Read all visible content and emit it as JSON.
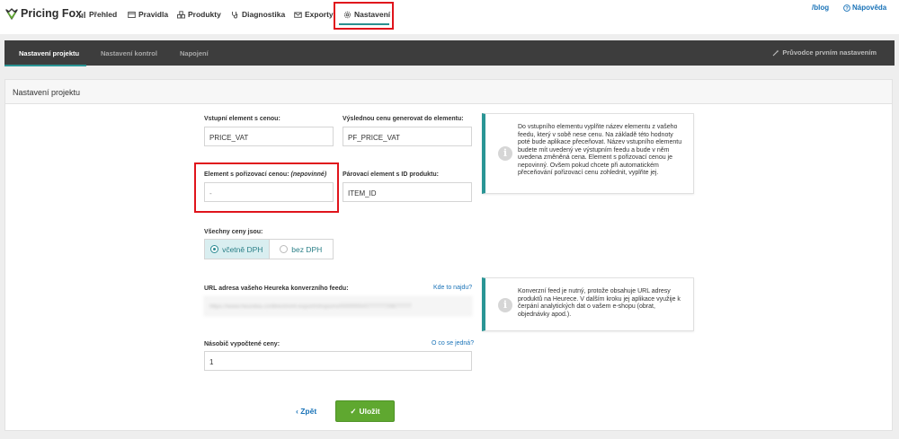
{
  "brand": {
    "name": "Pricing Fox"
  },
  "nav": {
    "items": [
      {
        "label": "Přehled",
        "icon": "chart-icon"
      },
      {
        "label": "Pravidla",
        "icon": "window-icon"
      },
      {
        "label": "Produkty",
        "icon": "cubes-icon"
      },
      {
        "label": "Diagnostika",
        "icon": "stethoscope-icon"
      },
      {
        "label": "Exporty",
        "icon": "envelope-icon"
      },
      {
        "label": "Nastavení",
        "icon": "gear-icon",
        "active": true
      }
    ],
    "blog": "/blog",
    "help": "Nápověda"
  },
  "subnav": {
    "tabs": [
      {
        "label": "Nastavení projektu",
        "active": true
      },
      {
        "label": "Nastavení kontrol"
      },
      {
        "label": "Napojení"
      }
    ],
    "wizard": "Průvodce prvním nastavením"
  },
  "panel": {
    "title": "Nastavení projektu",
    "input_element": {
      "label": "Vstupní element s cenou:",
      "value": "PRICE_VAT"
    },
    "output_element": {
      "label": "Výslednou cenu generovat do elementu:",
      "value": "PF_PRICE_VAT"
    },
    "purchase_element": {
      "label": "Element s pořizovací cenou:",
      "label_optional": "(nepovinné)",
      "value": "-"
    },
    "pairing_element": {
      "label": "Párovací element s ID produktu:",
      "value": "ITEM_ID"
    },
    "info_price": "Do vstupního elementu vyplňte název elementu z vašeho feedu, který v sobě nese cenu. Na základě této hodnoty poté bude aplikace přeceňovat. Název vstupního elementu budete mít uvedený ve výstupním feedu a bude v něm uvedena změněná cena. Element s pořizovací cenou je nepovinný. Ovšem pokud chcete při automatickém přeceňování pořizovací cenu zohlednit, vyplňte jej.",
    "prices": {
      "label": "Všechny ceny jsou:",
      "with_vat": "včetně DPH",
      "without_vat": "bez DPH",
      "selected": "with_vat"
    },
    "heureka_url": {
      "label": "URL adresa vašeho Heureka konverzního feedu:",
      "help": "Kde to najdu?",
      "value": "https://www.heureka.cz/direct/xml-export/shops/ro/0000000/0777777/0877777"
    },
    "info_feed": "Konverzní feed je nutný, protože obsahuje URL adresy produktů na Heurece. V dalším kroku jej aplikace využije k čerpání analytických dat o vašem e-shopu (obrat, objednávky apod.).",
    "multiplier": {
      "label": "Násobič vypočtené ceny:",
      "help": "O co se jedná?",
      "value": "1"
    },
    "back": "Zpět",
    "save": "Uložit"
  },
  "colors": {
    "accent": "#2a9595",
    "save": "#5fa830",
    "highlight": "#e0141c",
    "link": "#1a73b8"
  }
}
